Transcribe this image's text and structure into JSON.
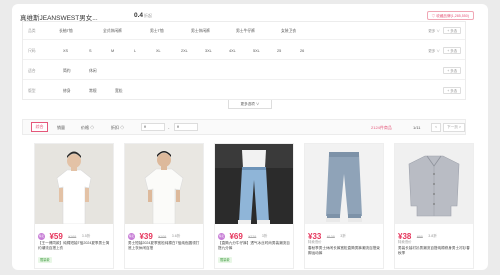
{
  "header": {
    "shop_name": "真维斯JEANSWEST男女...",
    "score": "0.4",
    "score_unit": "折起",
    "favorite_label": "♡ 收藏品牌(1,285,550)"
  },
  "filters": {
    "more_label": "更多 ∨",
    "multi_label": "+ 多选",
    "more_options_label": "更多选项 ∨",
    "rows": [
      {
        "label": "品类",
        "options": [
          "长袖T恤",
          "全式休闲裤",
          "男士T恤",
          "男士休闲裤",
          "男士牛仔裤",
          "女装卫衣"
        ],
        "has_more": true
      },
      {
        "label": "尺码",
        "options": [
          "XS",
          "S",
          "M",
          "L",
          "XL",
          "2XL",
          "3XL",
          "4XL",
          "5XL",
          "25",
          "26"
        ],
        "has_more": true
      },
      {
        "label": "适合",
        "options": [
          "简约",
          "休闲"
        ],
        "has_more": false
      },
      {
        "label": "版型",
        "options": [
          "修身",
          "常规",
          "宽松"
        ],
        "has_more": false
      }
    ]
  },
  "sortbar": {
    "default": "综合",
    "sales": "销量",
    "price": "价格 ◇",
    "discount": "折扣 ◇",
    "price_min": "¥",
    "price_max": "¥",
    "dash": "-",
    "count": "2124件商品",
    "page": "1/11",
    "prev": "<",
    "next": "下一页 >"
  },
  "products": [
    {
      "tag": "特卖",
      "price": "¥59",
      "orig": "¥169",
      "discount": "3.5折",
      "subtitle": "",
      "title": "【王一博同款】纯棉短袖T恤2024夏季男士简约潮流百搭上衣",
      "badge": "限量款"
    },
    {
      "tag": "特卖",
      "price": "¥39",
      "orig": "¥109",
      "discount": "3.6折",
      "subtitle": "",
      "title": "男士短袖2024夏季宽松纯棉白T恤纯色圆领打底上衣休闲百搭",
      "badge": ""
    },
    {
      "tag": "特卖",
      "price": "¥69",
      "orig": "¥229",
      "discount": "3折",
      "subtitle": "",
      "title": "【直筒九分牛仔裤】透气冰丝时尚男装潮流百搭九分裤",
      "badge": "限量款"
    },
    {
      "tag": "",
      "price": "¥33",
      "orig": "¥109",
      "discount": "3折",
      "subtitle": "特卖低价",
      "title": "春秋季男士休闲长裤宽松直筒男裤潮流百搭束脚运动裤",
      "badge": ""
    },
    {
      "tag": "",
      "price": "¥38",
      "orig": "¥99",
      "discount": "3.8折",
      "subtitle": "特卖低价",
      "title": "男装长袖衬衫男潮流百搭纯棉修身男士衬衫春秋季",
      "badge": ""
    }
  ]
}
